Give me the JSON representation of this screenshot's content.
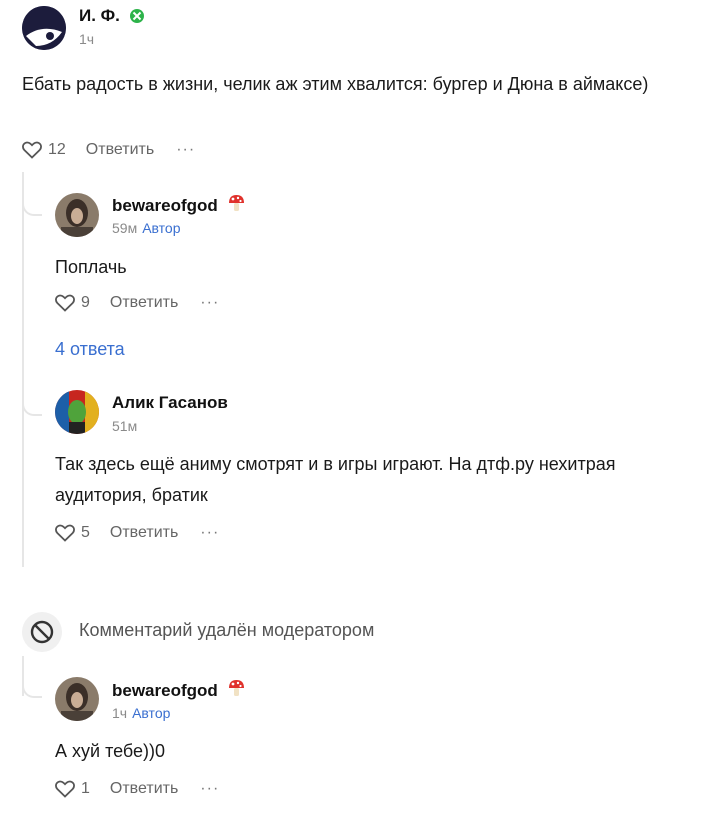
{
  "comments": {
    "root": {
      "author": "И. Ф.",
      "time": "1ч",
      "text": "Ебать радость в жизни, челик аж этим хвалится: бургер и Дюна в аймаксе)",
      "likes": "12",
      "reply_label": "Ответить",
      "more_label": "···"
    },
    "reply1": {
      "author": "bewareofgod",
      "time": "59м",
      "role": "Автор",
      "text": "Поплачь",
      "likes": "9",
      "reply_label": "Ответить",
      "more_label": "···",
      "replies_link": "4 ответа"
    },
    "reply2": {
      "author": "Алик Гасанов",
      "time": "51м",
      "text": "Так здесь ещё аниму смотрят и в игры играют. На дтф.ру нехитрая аудитория, братик",
      "likes": "5",
      "reply_label": "Ответить",
      "more_label": "···"
    },
    "deleted": {
      "text": "Комментарий удалён модератором"
    },
    "reply3": {
      "author": "bewareofgod",
      "time": "1ч",
      "role": "Автор",
      "text": "А хуй тебе))0",
      "likes": "1",
      "reply_label": "Ответить",
      "more_label": "···"
    }
  },
  "colors": {
    "link": "#3a6fd0",
    "badge_green": "#2db34a",
    "mushroom_red": "#e0322c"
  },
  "icons": {
    "root_badge": "xbox-badge-icon",
    "author_badge": "mushroom-badge-icon",
    "like": "heart-icon",
    "deleted": "prohibited-icon"
  }
}
